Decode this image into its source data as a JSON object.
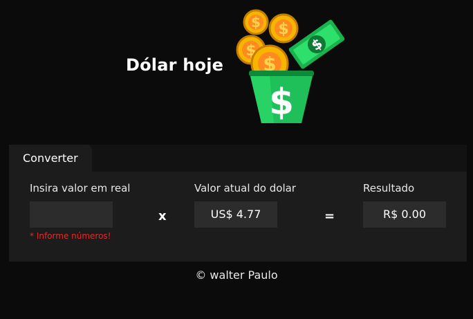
{
  "header": {
    "title": "Dólar hoje",
    "logo_icon": "dollar-bucket-icon"
  },
  "converter": {
    "tab_label": "Converter",
    "input_label": "Insira valor em real",
    "input_value": "",
    "input_placeholder": "",
    "error_text": "* Informe números!",
    "multiply_symbol": "x",
    "rate_label": "Valor atual do dolar",
    "rate_value": "US$ 4.77",
    "equals_symbol": "=",
    "result_label": "Resultado",
    "result_value": "R$ 0.00"
  },
  "footer": {
    "text": "© walter Paulo"
  },
  "colors": {
    "background": "#0b0b0b",
    "panel": "#1c1c1c",
    "field": "#2c2c2c",
    "error": "#e52b2b",
    "coin": "#f5a800",
    "bucket": "#1fbf59"
  }
}
